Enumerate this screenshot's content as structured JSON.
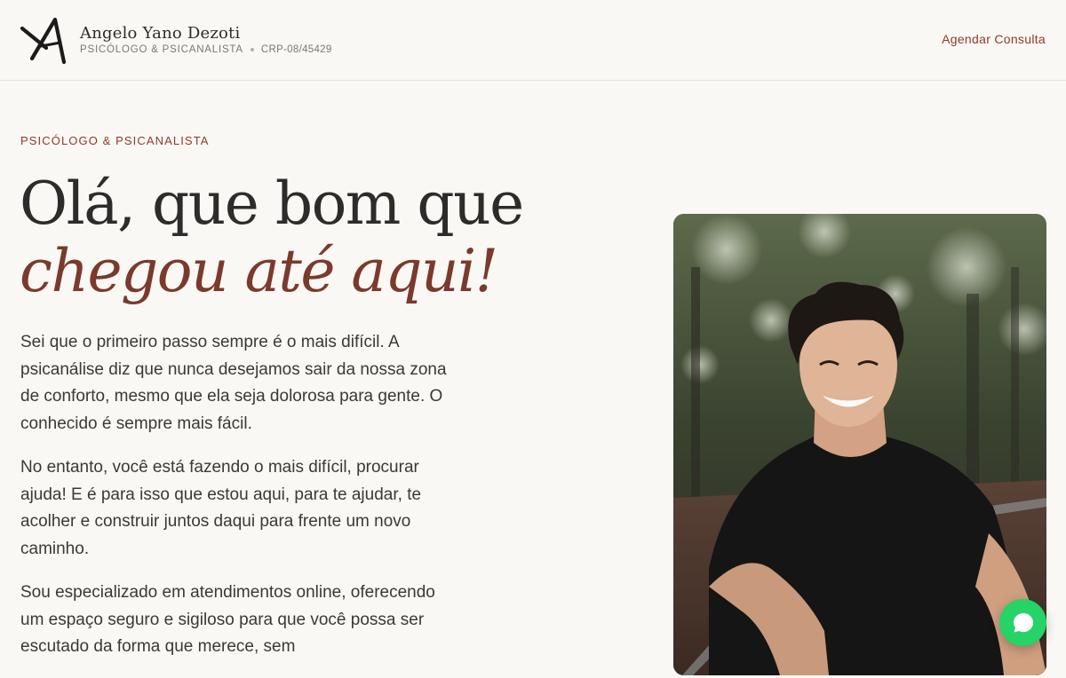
{
  "header": {
    "brand_name": "Angelo Yano Dezoti",
    "brand_role": "PSICÓLOGO & PSICANALISTA",
    "brand_crp": "CRP-08/45429",
    "cta_label": "Agendar Consulta",
    "logo_icon": "monogram-a-icon"
  },
  "hero": {
    "eyebrow": "PSICÓLOGO & PSICANALISTA",
    "headline_line1": "Olá, que bom que",
    "headline_line2": "chegou até aqui!",
    "paragraphs": [
      "Sei que o primeiro passo sempre é o mais difícil. A psicanálise diz que nunca desejamos sair da nossa zona de conforto, mesmo que ela seja dolorosa para gente. O conhecido é sempre mais fácil.",
      "No entanto, você está fazendo o mais difícil, procurar ajuda! E é para isso que estou aqui, para te ajudar, te acolher e construir juntos daqui para frente um novo caminho.",
      "Sou especializado em atendimentos online, oferecendo um espaço seguro e sigiloso para que você possa ser escutado da forma que merece, sem"
    ]
  },
  "chat_button": {
    "icon": "whatsapp-icon"
  },
  "colors": {
    "background": "#faf8f4",
    "accent": "#8a3b2a",
    "text": "#2e2c2a",
    "chat_green": "#25d366"
  }
}
